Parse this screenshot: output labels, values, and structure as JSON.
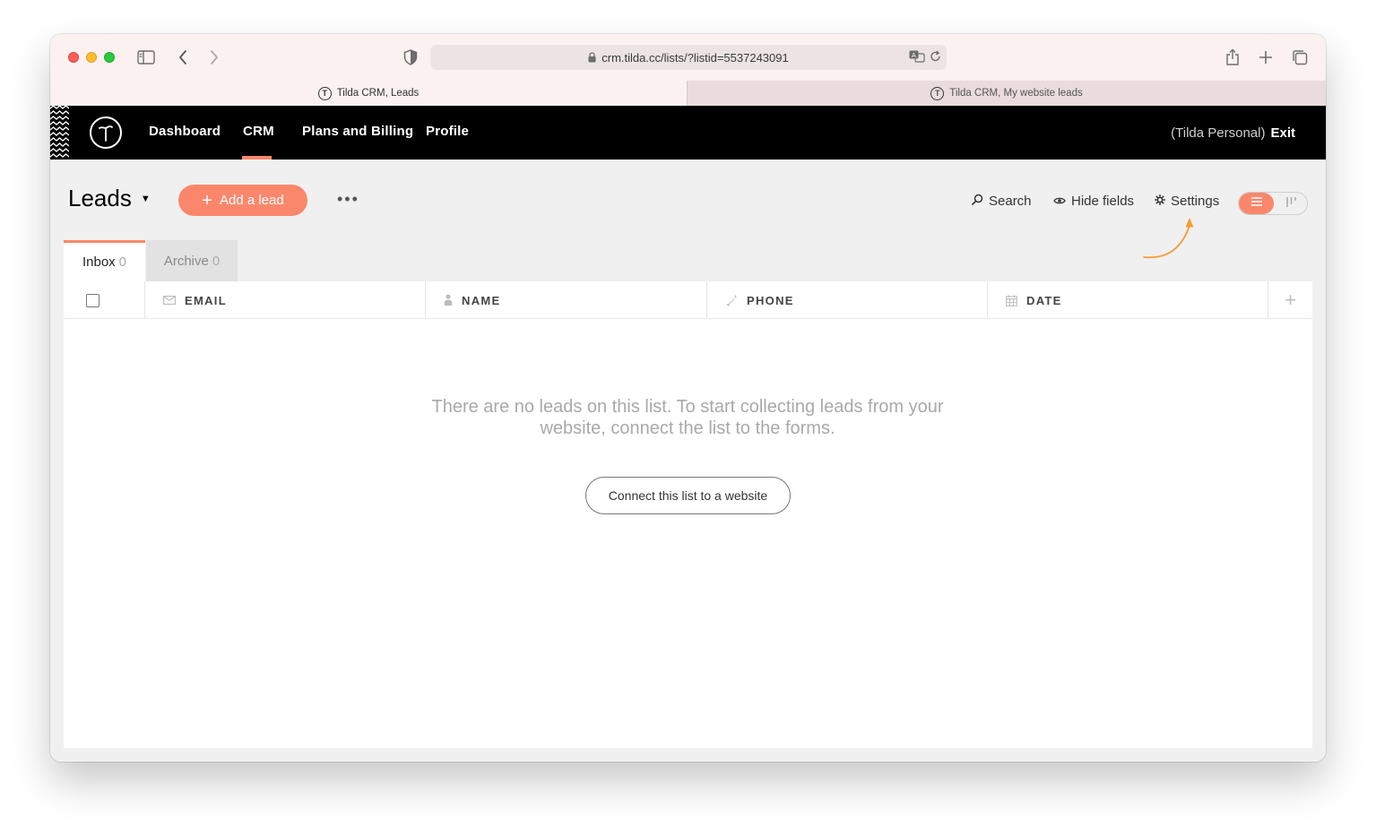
{
  "browser": {
    "url": "crm.tilda.cc/lists/?listid=5537243091",
    "tabs": [
      {
        "label": "Tilda CRM, Leads",
        "active": true
      },
      {
        "label": "Tilda CRM, My website leads",
        "active": false
      }
    ]
  },
  "nav": {
    "logo": "T",
    "items": [
      "Dashboard",
      "CRM",
      "Plans and Billing",
      "Profile"
    ],
    "active_item": "CRM",
    "account": "(Tilda Personal)",
    "exit": "Exit"
  },
  "toolbar": {
    "title": "Leads",
    "add_button": "Add a lead",
    "more": "•••",
    "search": "Search",
    "hide_fields": "Hide fields",
    "settings": "Settings"
  },
  "list_tabs": [
    {
      "label": "Inbox",
      "count": "0",
      "active": true
    },
    {
      "label": "Archive",
      "count": "0",
      "active": false
    }
  ],
  "table": {
    "columns": [
      "EMAIL",
      "NAME",
      "PHONE",
      "DATE"
    ],
    "add_column": "+"
  },
  "empty_state": {
    "message": "There are no leads on this list. To start collecting leads from your website, connect the list to the forms.",
    "button": "Connect this list to a website"
  },
  "colors": {
    "accent": "#fa876b",
    "nav_bg": "#000000",
    "annotation_arrow": "#f39c32"
  }
}
